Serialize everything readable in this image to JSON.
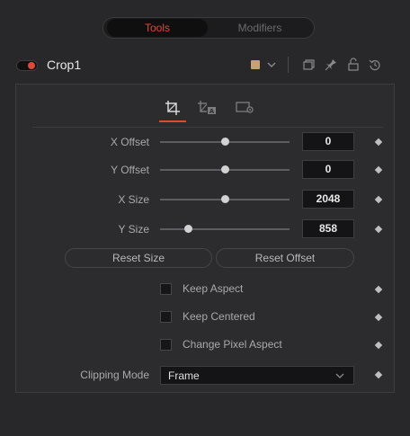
{
  "tabs": {
    "tools": "Tools",
    "modifiers": "Modifiers"
  },
  "header": {
    "node_name": "Crop1",
    "color_swatch": "#c6a178",
    "icons": [
      "toggle-icon",
      "chevron-down-icon",
      "window-icon",
      "pin-icon",
      "lock-icon",
      "reset-icon"
    ]
  },
  "subtabs": [
    {
      "name": "crop-icon",
      "active": true
    },
    {
      "name": "auto-crop-icon",
      "active": false
    },
    {
      "name": "settings-icon",
      "active": false
    }
  ],
  "controls": {
    "x_offset": {
      "label": "X Offset",
      "value": "0"
    },
    "y_offset": {
      "label": "Y Offset",
      "value": "0"
    },
    "x_size": {
      "label": "X Size",
      "value": "2048"
    },
    "y_size": {
      "label": "Y Size",
      "value": "858"
    }
  },
  "buttons": {
    "reset_size": "Reset Size",
    "reset_offset": "Reset Offset"
  },
  "checkboxes": {
    "keep_aspect": "Keep Aspect",
    "keep_centered": "Keep Centered",
    "change_pixel_aspect": "Change Pixel Aspect"
  },
  "clipping": {
    "label": "Clipping Mode",
    "value": "Frame"
  },
  "colors": {
    "accent": "#e0483a",
    "background": "#28282b"
  }
}
